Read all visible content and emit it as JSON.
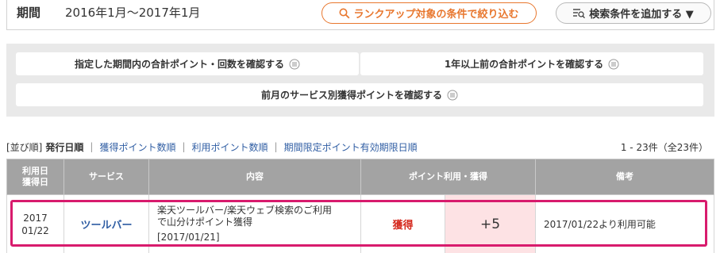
{
  "period": {
    "label": "期間",
    "value": "2016年1月〜2017年1月",
    "rank_button": "ランクアップ対象の条件で絞り込む",
    "add_condition_button": "検索条件を追加する ▼"
  },
  "confirm": {
    "button1": "指定した期間内の合計ポイント・回数を確認する",
    "button2": "1年以上前の合計ポイントを確認する",
    "button3": "前月のサービス別獲得ポイントを確認する"
  },
  "sort": {
    "prefix": "[並び順]",
    "items": [
      "発行日順",
      "獲得ポイント数順",
      "利用ポイント数順",
      "期間限定ポイント有効期限日順"
    ],
    "count": "1 - 23件（全23件）"
  },
  "table": {
    "headers": {
      "date": "利用日\n獲得日",
      "service": "サービス",
      "content": "内容",
      "points": "ポイント利用・獲得",
      "note": "備考"
    },
    "rows": [
      {
        "date_year": "2017",
        "date_day": "01/22",
        "service": "ツールバー",
        "desc_line1": "楽天ツールバー/楽天ウェブ検索のご利用",
        "desc_line2": "で山分けポイント獲得",
        "desc_line3": "[2017/01/21]",
        "type": "獲得",
        "points": "+5",
        "note": "2017/01/22より利用可能"
      }
    ]
  },
  "colors": {
    "accent_orange": "#e8772e",
    "link_blue": "#2f5da3",
    "earn_red": "#d52a1f",
    "highlight_pink": "#d81b6d",
    "points_bg": "#fde2e4"
  }
}
